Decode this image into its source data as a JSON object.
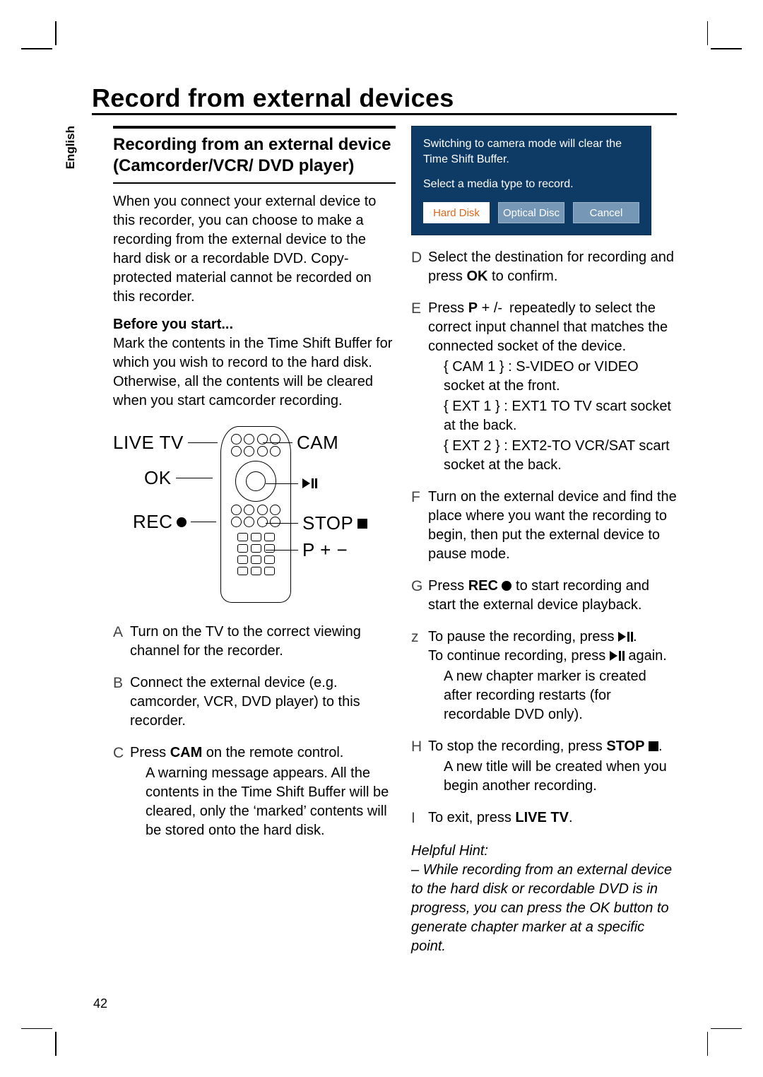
{
  "page_number": "42",
  "side_tab": "English",
  "title": "Record from external devices",
  "subhead": "Recording from an external device (Camcorder/VCR/ DVD player)",
  "intro": "When you connect your external device to this recorder, you can choose to make a recording from the external device to the hard disk or a recordable DVD. Copy-protected material cannot be recorded on this recorder.",
  "before_label": "Before you start...",
  "before_text": "Mark the contents in the Time Shift Buffer for which you wish to record to the hard disk. Otherwise, all the contents will be cleared when you start camcorder recording.",
  "diagram": {
    "labels": {
      "live_tv": "LIVE TV",
      "ok": "OK",
      "rec": "REC",
      "cam": "CAM",
      "play_pause": "",
      "stop": "STOP",
      "p_plus_minus": "P + −"
    }
  },
  "steps_left": [
    {
      "mark": "A",
      "text": "Turn on the TV to the correct viewing channel for the recorder."
    },
    {
      "mark": "B",
      "text": "Connect the external device (e.g. camcorder, VCR, DVD player) to this recorder."
    },
    {
      "mark": "C",
      "text_pre": "Press ",
      "text_strong": "CAM",
      "text_post": " on the remote control.",
      "sub": "A warning message appears. All the contents in the Time Shift Buffer will be cleared, only the ‘marked’ contents will be stored onto the hard disk."
    }
  ],
  "dialog": {
    "line1": "Switching to camera mode will clear the Time Shift Buffer.",
    "line2": "Select a media type to record.",
    "buttons": [
      "Hard Disk",
      "Optical Disc",
      "Cancel"
    ]
  },
  "steps_right": [
    {
      "mark": "D",
      "text_pre": "Select the destination for recording and press ",
      "text_strong": "OK",
      "text_post": " to confirm."
    },
    {
      "mark": "E",
      "text_pre": "Press ",
      "text_strong": "P",
      "text_post": " + /- repeatedly to select the correct input channel that matches the connected socket of the device.",
      "subs": [
        "{ CAM 1 } : S-VIDEO or VIDEO socket at the front.",
        "{ EXT 1 } : EXT1 TO TV scart socket at the back.",
        "{ EXT 2 } : EXT2-TO VCR/SAT scart socket at the back."
      ]
    },
    {
      "mark": "F",
      "text": "Turn on the external device and find the place where you want the recording to begin, then put the external device to pause mode."
    },
    {
      "mark": "G",
      "text_pre": "Press ",
      "text_strong": "REC",
      "text_post": " to start recording and start the external device playback.",
      "has_rec_glyph": true
    },
    {
      "mark": "z",
      "tip": true,
      "line1_pre": "To pause the recording, press ",
      "line2_pre": "To continue recording, press ",
      "line2_post": " again.",
      "sub": "A new chapter marker is created after recording restarts (for recordable DVD only)."
    },
    {
      "mark": "H",
      "text_pre": "To stop the recording, press ",
      "text_strong": "STOP",
      "text_post": ".",
      "has_stop_glyph": true,
      "sub": "A new title will be created when you begin another recording."
    },
    {
      "mark": "I",
      "text_pre": "To exit, press ",
      "text_strong": "LIVE TV",
      "text_post": "."
    }
  ],
  "hint_title": "Helpful Hint:",
  "hint": "– While recording from an external device to the hard disk or recordable DVD is in progress, you can press the OK button to generate chapter marker at a specific point."
}
